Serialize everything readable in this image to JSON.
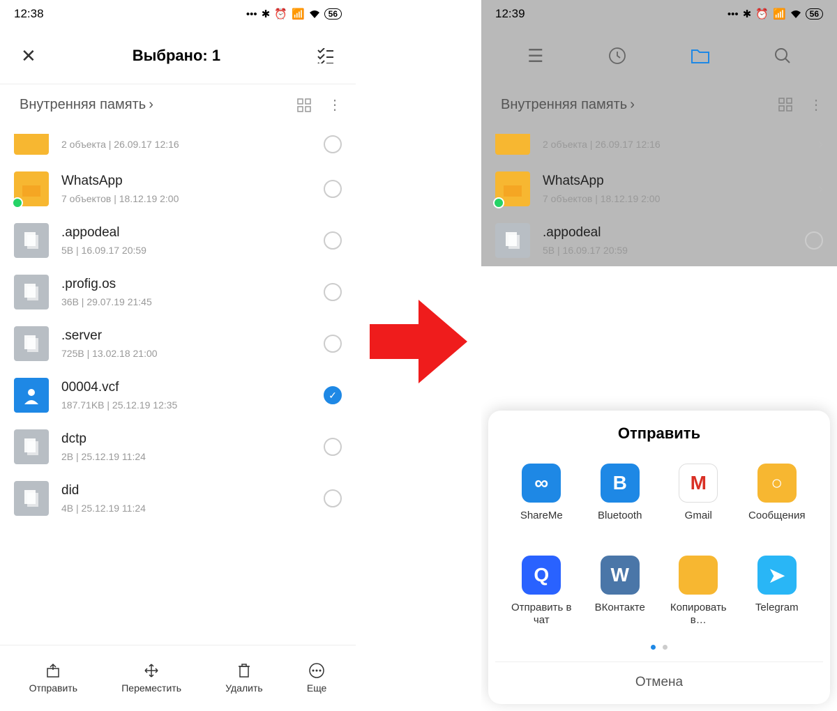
{
  "left": {
    "status": {
      "time": "12:38",
      "battery": "56"
    },
    "header": {
      "title": "Выбрано: 1"
    },
    "breadcrumb": "Внутренняя память",
    "items": [
      {
        "name": "",
        "meta": "2 объекта  |  26.09.17 12:16",
        "type": "folder",
        "selected": false
      },
      {
        "name": "WhatsApp",
        "meta": "7 объектов  |  18.12.19 2:00",
        "type": "folder",
        "badge": "wa",
        "selected": false
      },
      {
        "name": ".appodeal",
        "meta": "5B  |  16.09.17 20:59",
        "type": "file",
        "selected": false
      },
      {
        "name": ".profig.os",
        "meta": "36B  |  29.07.19 21:45",
        "type": "file",
        "selected": false
      },
      {
        "name": ".server",
        "meta": "725B  |  13.02.18 21:00",
        "type": "file",
        "selected": false
      },
      {
        "name": "00004.vcf",
        "meta": "187.71KB  |  25.12.19 12:35",
        "type": "contact",
        "selected": true
      },
      {
        "name": "dctp",
        "meta": "2B  |  25.12.19 11:24",
        "type": "file",
        "selected": false
      },
      {
        "name": "did",
        "meta": "4B  |  25.12.19 11:24",
        "type": "file",
        "selected": false
      }
    ],
    "bottom": {
      "send": "Отправить",
      "move": "Переместить",
      "delete": "Удалить",
      "more": "Еще"
    }
  },
  "right": {
    "status": {
      "time": "12:39",
      "battery": "56"
    },
    "breadcrumb": "Внутренняя память",
    "items": [
      {
        "name": "",
        "meta": "2 объекта  |  26.09.17 12:16",
        "type": "folder"
      },
      {
        "name": "WhatsApp",
        "meta": "7 объектов  |  18.12.19 2:00",
        "type": "folder",
        "badge": "wa"
      },
      {
        "name": ".appodeal",
        "meta": "5B  |  16.09.17 20:59",
        "type": "file"
      }
    ],
    "sheet": {
      "title": "Отправить",
      "apps": [
        {
          "label": "ShareMe",
          "bg": "#1e88e5",
          "glyph": "∞"
        },
        {
          "label": "Bluetooth",
          "bg": "#1e88e5",
          "glyph": "B"
        },
        {
          "label": "Gmail",
          "bg": "#fff",
          "glyph": "M",
          "fg": "#d93025",
          "border": "1"
        },
        {
          "label": "Сообщения",
          "bg": "#f7b731",
          "glyph": "○"
        },
        {
          "label": "Отправить в чат",
          "bg": "#2962ff",
          "glyph": "Q"
        },
        {
          "label": "ВКонтакте",
          "bg": "#4a76a8",
          "glyph": "W"
        },
        {
          "label": "Копировать в…",
          "bg": "#f7b731",
          "glyph": ""
        },
        {
          "label": "Telegram",
          "bg": "#29b6f6",
          "glyph": "➤"
        }
      ],
      "cancel": "Отмена"
    }
  }
}
